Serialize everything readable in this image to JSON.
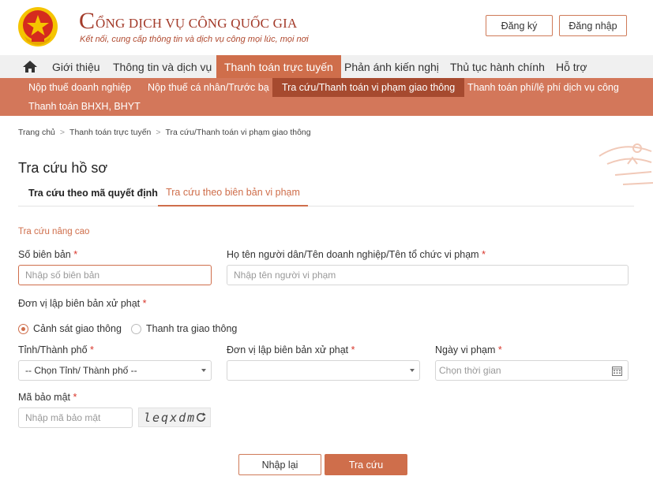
{
  "header": {
    "logo_initial": "C",
    "logo_rest": "ỔNG DỊCH VỤ CÔNG QUỐC GIA",
    "slogan": "Kết nối, cung cấp thông tin và dịch vụ công mọi lúc, mọi nơi",
    "register_label": "Đăng ký",
    "login_label": "Đăng nhập"
  },
  "mainnav": {
    "home_icon": "home-icon",
    "items": [
      "Giới thiệu",
      "Thông tin và dịch vụ",
      "Thanh toán trực tuyến",
      "Phản ánh kiến nghị",
      "Thủ tục hành chính",
      "Hỗ trợ"
    ],
    "active_index": 2
  },
  "subnav": {
    "items": [
      "Nộp thuế doanh nghiệp",
      "Nộp thuế cá nhân/Trước bạ",
      "Tra cứu/Thanh toán vi phạm giao thông",
      "Thanh toán phí/lệ phí dịch vụ công",
      "Thanh toán BHXH, BHYT"
    ],
    "active_index": 2
  },
  "breadcrumb": [
    "Trang chủ",
    "Thanh toán trực tuyến",
    "Tra cứu/Thanh toán vi phạm giao thông"
  ],
  "breadcrumb_sep": ">",
  "page_title": "Tra cứu hồ sơ",
  "tabs": [
    "Tra cứu theo mã quyết định",
    "Tra cứu theo biên bản vi phạm"
  ],
  "active_tab": 1,
  "form": {
    "advanced_label": "Tra cứu nâng cao",
    "record_no": {
      "label": "Số biên bản",
      "placeholder": "Nhập số biên bản"
    },
    "person_name": {
      "label": "Họ tên người dân/Tên doanh nghiệp/Tên tổ chức vi phạm",
      "placeholder": "Nhập tên người vi phạm"
    },
    "issuer_type": {
      "label": "Đơn vị lập biên bản xử phạt",
      "options": [
        "Cảnh sát giao thông",
        "Thanh tra giao thông"
      ],
      "selected": 0
    },
    "province": {
      "label": "Tỉnh/Thành phố",
      "value": "-- Chọn Tỉnh/ Thành phố --"
    },
    "issuer_unit": {
      "label": "Đơn vị lập biên bản xử phạt",
      "value": ""
    },
    "violation_date": {
      "label": "Ngày vi phạm",
      "placeholder": "Chọn thời gian"
    },
    "captcha": {
      "label": "Mã bảo mật",
      "placeholder": "Nhập mã bảo mật",
      "code": "leqxdm"
    },
    "required_mark": "*",
    "reset_label": "Nhập lại",
    "search_label": "Tra cứu"
  },
  "colors": {
    "accent": "#cf6e4b",
    "subnav_bg": "#d3775a",
    "brand_red": "#a33b2a",
    "emblem_red": "#d52b1e",
    "emblem_gold": "#f5c400"
  }
}
